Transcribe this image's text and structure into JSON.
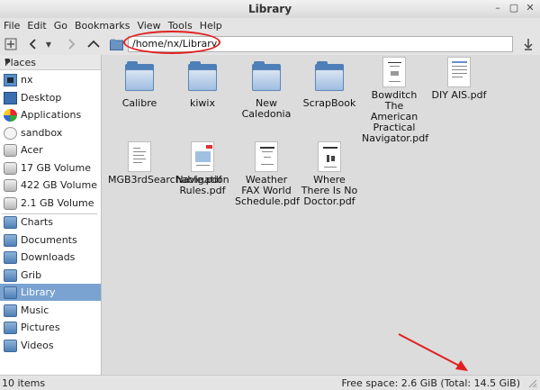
{
  "window": {
    "title": "Library"
  },
  "menu": [
    "File",
    "Edit",
    "Go",
    "Bookmarks",
    "View",
    "Tools",
    "Help"
  ],
  "toolbar": {
    "location_path": "/home/nx/Library"
  },
  "sidebar": {
    "header": "Places",
    "items": [
      {
        "label": "nx",
        "icon": "home-icon"
      },
      {
        "label": "Desktop",
        "icon": "desktop-icon"
      },
      {
        "label": "Applications",
        "icon": "applications-icon"
      },
      {
        "label": "sandbox",
        "icon": "sandbox-icon"
      },
      {
        "label": "Acer",
        "icon": "drive-icon"
      },
      {
        "label": "17 GB Volume",
        "icon": "drive-icon"
      },
      {
        "label": "422 GB Volume",
        "icon": "drive-icon"
      },
      {
        "label": "2.1 GB Volume",
        "icon": "drive-icon"
      },
      {
        "label": "Charts",
        "icon": "folder-icon"
      },
      {
        "label": "Documents",
        "icon": "folder-icon"
      },
      {
        "label": "Downloads",
        "icon": "folder-icon"
      },
      {
        "label": "Grib",
        "icon": "folder-icon"
      },
      {
        "label": "Library",
        "icon": "folder-icon",
        "selected": true
      },
      {
        "label": "Music",
        "icon": "folder-icon"
      },
      {
        "label": "Pictures",
        "icon": "folder-icon"
      },
      {
        "label": "Videos",
        "icon": "folder-icon"
      }
    ]
  },
  "files": [
    {
      "name": "Calibre",
      "type": "folder"
    },
    {
      "name": "kiwix",
      "type": "folder"
    },
    {
      "name": "New Caledonia",
      "type": "folder"
    },
    {
      "name": "ScrapBook",
      "type": "folder"
    },
    {
      "name": "Bowditch The American Practical Navigator.pdf",
      "type": "pdf"
    },
    {
      "name": "DIY AIS.pdf",
      "type": "pdf"
    },
    {
      "name": "MGB3rdSearchable.pdf",
      "type": "pdf"
    },
    {
      "name": "Navigation Rules.pdf",
      "type": "pdf"
    },
    {
      "name": "Weather FAX World Schedule.pdf",
      "type": "pdf"
    },
    {
      "name": "Where There Is No Doctor.pdf",
      "type": "pdf"
    }
  ],
  "status": {
    "item_count": "10 items",
    "free_space": "Free space: 2.6 GiB (Total: 14.5 GiB)"
  },
  "colors": {
    "selection": "#7aa3d1",
    "annotation": "#e02020"
  }
}
